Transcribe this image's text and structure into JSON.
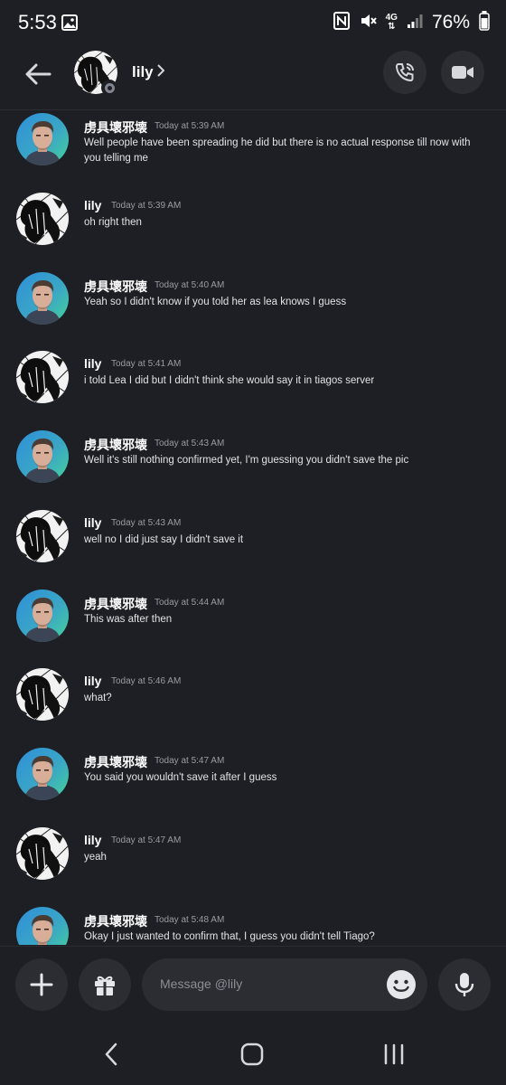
{
  "status_bar": {
    "time": "5:53",
    "battery": "76%",
    "network": "4G",
    "icons": [
      "gallery-icon",
      "nfc-icon",
      "mute-icon",
      "signal-icon",
      "battery-icon"
    ]
  },
  "header": {
    "contact_name": "lily",
    "icons": [
      "back-arrow-icon",
      "chevron-right-icon",
      "phone-call-icon",
      "video-call-icon"
    ]
  },
  "messages": [
    {
      "author": "虏具壞邪壊",
      "time": "Today at 5:39 AM",
      "text": "Well people have been spreading he did but there is no actual response till now with you telling me",
      "avatar": "male-avatar"
    },
    {
      "author": "lily",
      "time": "Today at 5:39 AM",
      "text": "oh right then",
      "avatar": "lily-avatar"
    },
    {
      "author": "虏具壞邪壊",
      "time": "Today at 5:40 AM",
      "text": "Yeah so I didn't know if you told her as lea knows I guess",
      "avatar": "male-avatar"
    },
    {
      "author": "lily",
      "time": "Today at 5:41 AM",
      "text": "i told Lea I did but I didn't think she would say it in tiagos server",
      "avatar": "lily-avatar"
    },
    {
      "author": "虏具壞邪壊",
      "time": "Today at 5:43 AM",
      "text": "Well it's still nothing confirmed yet, I'm guessing you didn't save the pic",
      "avatar": "male-avatar"
    },
    {
      "author": "lily",
      "time": "Today at 5:43 AM",
      "text": "well no I did just say I didn't save it",
      "avatar": "lily-avatar"
    },
    {
      "author": "虏具壞邪壊",
      "time": "Today at 5:44 AM",
      "text": "This was after then",
      "avatar": "male-avatar"
    },
    {
      "author": "lily",
      "time": "Today at 5:46 AM",
      "text": "what?",
      "avatar": "lily-avatar"
    },
    {
      "author": "虏具壞邪壊",
      "time": "Today at 5:47 AM",
      "text": "You said you wouldn't save it after I guess",
      "avatar": "male-avatar"
    },
    {
      "author": "lily",
      "time": "Today at 5:47 AM",
      "text": "yeah",
      "avatar": "lily-avatar"
    },
    {
      "author": "虏具壞邪壊",
      "time": "Today at 5:48 AM",
      "text": "Okay I just wanted to confirm that, I guess you didn't tell Tiago?",
      "avatar": "male-avatar"
    }
  ],
  "composer": {
    "placeholder": "Message @lily",
    "icons": [
      "plus-icon",
      "gift-icon",
      "emoji-icon",
      "microphone-icon"
    ]
  },
  "nav_bar": {
    "icons": [
      "nav-back-icon",
      "nav-home-icon",
      "nav-recents-icon"
    ]
  },
  "colors": {
    "background": "#1e1f24",
    "button_bg": "#2b2d33",
    "text_primary": "#ffffff",
    "text_muted": "#9a9ca3",
    "status_offline": "#80848e"
  }
}
